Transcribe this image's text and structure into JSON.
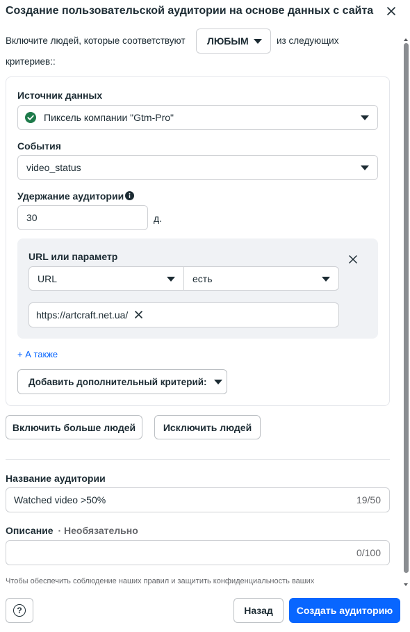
{
  "header": {
    "title": "Создание пользовательской аудитории на основе данных с сайта"
  },
  "include": {
    "prefix": "Включите людей, которые соответствуют",
    "match_value": "ЛЮБЫМ",
    "suffix": "из следующих",
    "suffix2": "критериев::"
  },
  "source": {
    "label": "Источник данных",
    "value": "Пиксель компании \"Gtm-Pro\"",
    "status_color": "#1d7a4a"
  },
  "events": {
    "label": "События",
    "value": "video_status"
  },
  "retention": {
    "label": "Удержание аудитории",
    "value": "30",
    "unit": "д."
  },
  "url_rule": {
    "label": "URL или параметр",
    "field": "URL",
    "operator": "есть",
    "tags": [
      "https://artcraft.net.ua/"
    ]
  },
  "also_link": "+ А также",
  "add_criteria": "Добавить дополнительный критерий:",
  "include_more": "Включить больше людей",
  "exclude": "Исключить людей",
  "audience_name": {
    "label": "Название аудитории",
    "value": "Watched video >50%",
    "counter": "19/50"
  },
  "description": {
    "label": "Описание",
    "optional": "· Необязательно",
    "value": "",
    "counter": "0/100"
  },
  "note": "Чтобы обеспечить соблюдение наших правил и защитить конфиденциальность ваших",
  "footer": {
    "help_icon": "?",
    "back": "Назад",
    "create": "Создать аудиторию"
  },
  "colors": {
    "accent": "#0866ff",
    "text": "#1c2b33",
    "muted": "#65676b"
  }
}
